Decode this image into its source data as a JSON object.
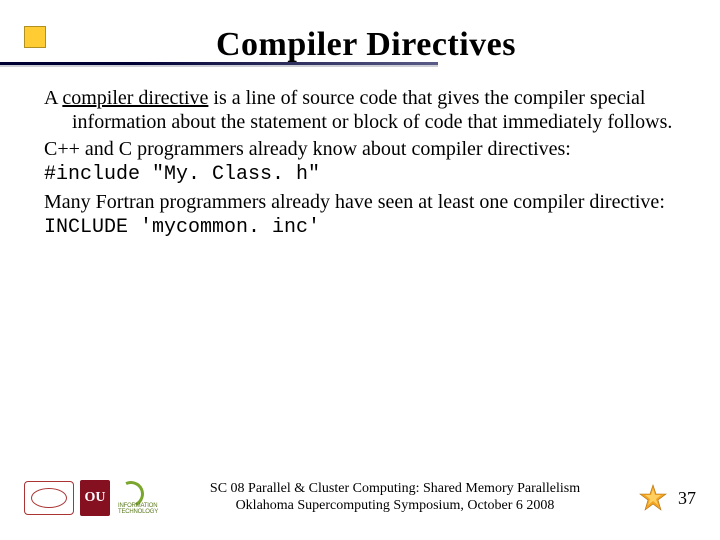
{
  "title": "Compiler Directives",
  "body": {
    "p1_a": "A ",
    "p1_term": "compiler directive",
    "p1_b": " is a line of source code that gives the compiler special information about the statement or block of code that immediately follows.",
    "p2": "C++ and C programmers already know about compiler directives:",
    "code1": "#include \"My. Class. h\"",
    "p3": "Many Fortran programmers already have seen at least one compiler directive:",
    "code2": "INCLUDE 'mycommon. inc'"
  },
  "footer": {
    "line1": "SC 08 Parallel & Cluster Computing: Shared Memory Parallelism",
    "line2": "Oklahoma Supercomputing Symposium, October 6 2008"
  },
  "logos": {
    "ou": "OU"
  },
  "slide_number": "37"
}
